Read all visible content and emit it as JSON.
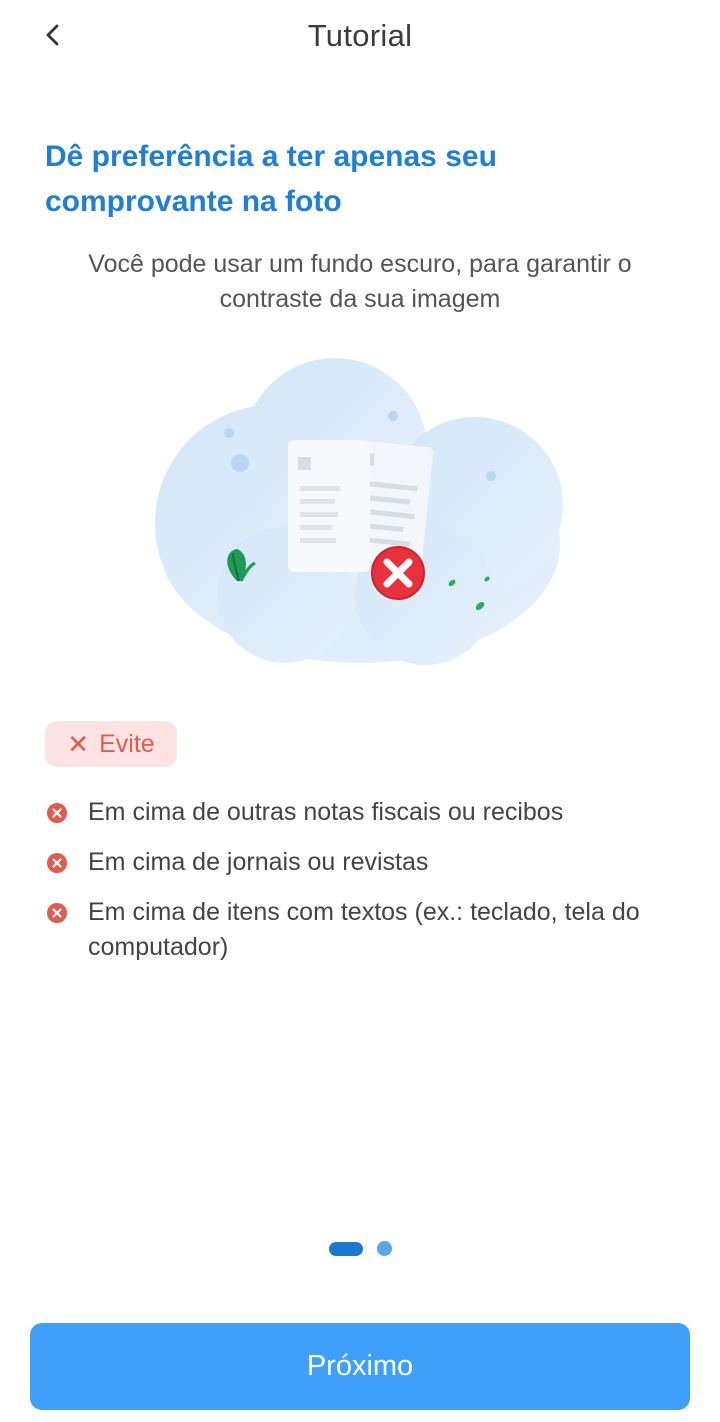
{
  "header": {
    "title": "Tutorial",
    "back_icon": "chevron-left-icon"
  },
  "content": {
    "headline": "Dê preferência a ter apenas seu comprovante na foto",
    "subtext": "Você pode usar um fundo escuro, para garantir o contraste da sua imagem"
  },
  "illustration": {
    "description_icon": "documents-with-error-icon"
  },
  "avoid": {
    "badge_icon": "close-icon",
    "badge_label": "Evite",
    "items": [
      "Em cima de outras notas fiscais ou recibos",
      "Em cima de jornais ou revistas",
      "Em cima de itens com textos (ex.: teclado, tela do computador)"
    ]
  },
  "pagination": {
    "current": 1,
    "total": 2
  },
  "footer": {
    "next_label": "Próximo"
  },
  "colors": {
    "primary": "#3ea0fa",
    "headline": "#1e7fd6",
    "error": "#e45a4f",
    "badge_bg": "#fde4e2"
  }
}
